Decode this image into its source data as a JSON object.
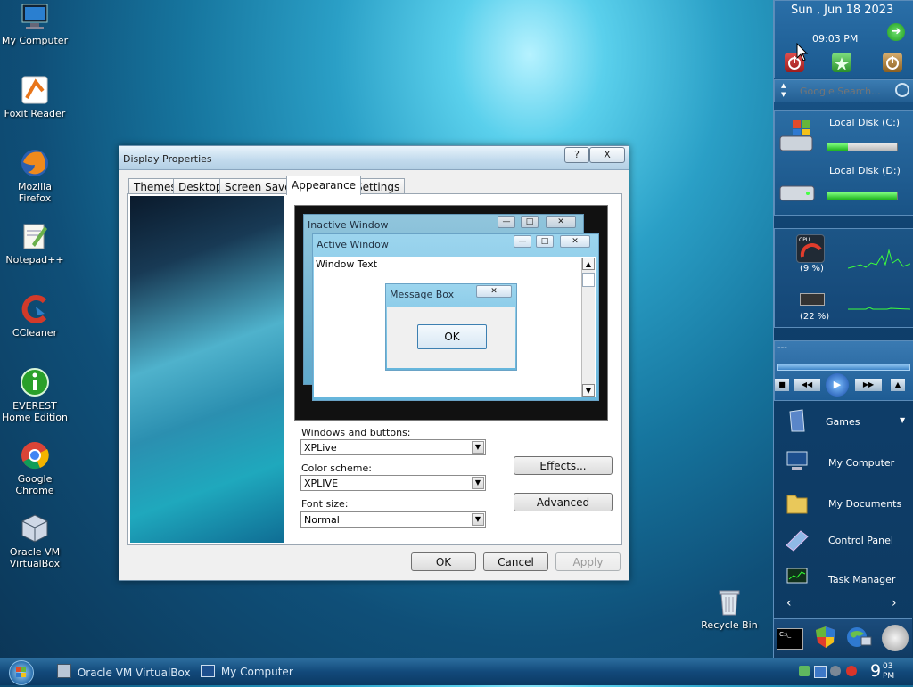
{
  "desktop": {
    "icons": [
      {
        "label": "My Computer"
      },
      {
        "label": "Foxit Reader"
      },
      {
        "label": "Mozilla Firefox"
      },
      {
        "label": "Notepad++"
      },
      {
        "label": "CCleaner"
      },
      {
        "label": "EVEREST Home Edition"
      },
      {
        "label": "Google Chrome"
      },
      {
        "label": "Oracle VM VirtualBox"
      }
    ],
    "recycle_bin": "Recycle Bin"
  },
  "dialog": {
    "title": "Display Properties",
    "help_btn": "?",
    "close_btn": "X",
    "tabs": [
      {
        "label": "Themes"
      },
      {
        "label": "Desktop"
      },
      {
        "label": "Screen Saver"
      },
      {
        "label": "Appearance",
        "active": true
      },
      {
        "label": "Settings"
      }
    ],
    "preview": {
      "inactive_title": "Inactive Window",
      "active_title": "Active Window",
      "window_text": "Window Text",
      "message_title": "Message Box",
      "ok": "OK"
    },
    "windows_and_buttons_label": "Windows and buttons:",
    "windows_and_buttons_value": "XPLive",
    "color_scheme_label": "Color scheme:",
    "color_scheme_value": "XPLIVE",
    "font_size_label": "Font size:",
    "font_size_value": "Normal",
    "effects_btn": "Effects...",
    "advanced_btn": "Advanced",
    "ok_btn": "OK",
    "cancel_btn": "Cancel",
    "apply_btn": "Apply"
  },
  "sidebar": {
    "date": "Sun , Jun 18 2023",
    "time": "09:03 PM",
    "search_placeholder": "Google Search...",
    "disks": [
      {
        "label": "Local Disk (C:)",
        "usage": 0.3
      },
      {
        "label": "Local Disk (D:)",
        "usage": 1.0
      }
    ],
    "cpu_label": "CPU",
    "cpu_percent": "(9 %)",
    "ram_percent": "(22 %)",
    "player_text": "---",
    "menu": [
      {
        "label": "Games"
      },
      {
        "label": "My Computer"
      },
      {
        "label": "My Documents"
      },
      {
        "label": "Control Panel"
      },
      {
        "label": "Task Manager"
      }
    ],
    "cmd_label": "C:\\_"
  },
  "taskbar": {
    "tasks": [
      {
        "label": "Oracle VM VirtualBox"
      },
      {
        "label": "My Computer"
      }
    ],
    "clock_hour": "9",
    "clock_min": "03",
    "clock_ampm": "PM"
  },
  "colors": {
    "accent": "#1a5c92",
    "taskbar": "#12497a",
    "progress": "#1fb31f"
  }
}
